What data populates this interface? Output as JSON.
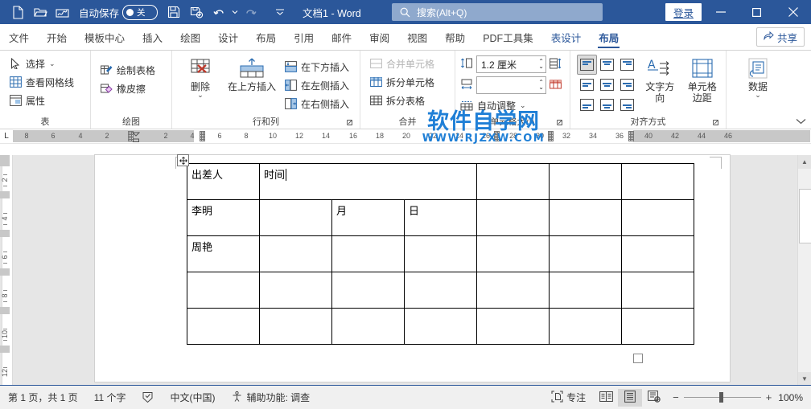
{
  "titlebar": {
    "qat": [
      {
        "name": "new-document-icon",
        "label": "新建"
      },
      {
        "name": "open-folder-icon",
        "label": "打开"
      },
      {
        "name": "signature-icon",
        "label": "签名"
      }
    ],
    "autosave_label": "自动保存",
    "autosave_state": "关",
    "qat2": [
      {
        "name": "save-icon",
        "label": "保存"
      },
      {
        "name": "save-as-icon",
        "label": "另存为"
      },
      {
        "name": "undo-icon",
        "label": "撤消"
      },
      {
        "name": "redo-icon",
        "label": "恢复"
      },
      {
        "name": "customize-qat-icon",
        "label": "自定义快速访问工具栏"
      }
    ],
    "document_title": "文档1  -  Word",
    "search_placeholder": "搜索(Alt+Q)",
    "signin_label": "登录",
    "window_buttons": [
      "最小化",
      "最大化",
      "关闭"
    ]
  },
  "tabs": [
    {
      "label": "文件",
      "style": "normal"
    },
    {
      "label": "开始",
      "style": "normal"
    },
    {
      "label": "模板中心",
      "style": "normal"
    },
    {
      "label": "插入",
      "style": "normal"
    },
    {
      "label": "绘图",
      "style": "normal"
    },
    {
      "label": "设计",
      "style": "normal"
    },
    {
      "label": "布局",
      "style": "normal"
    },
    {
      "label": "引用",
      "style": "normal"
    },
    {
      "label": "邮件",
      "style": "normal"
    },
    {
      "label": "审阅",
      "style": "normal"
    },
    {
      "label": "视图",
      "style": "normal"
    },
    {
      "label": "帮助",
      "style": "normal"
    },
    {
      "label": "PDF工具集",
      "style": "normal"
    },
    {
      "label": "表设计",
      "style": "blue"
    },
    {
      "label": "布局",
      "style": "active"
    }
  ],
  "share_label": "共享",
  "ribbon": {
    "groups": [
      {
        "title": "表",
        "items": [
          {
            "label": "选择",
            "icon": "select-arrow-icon",
            "dropdown": true
          },
          {
            "label": "查看网格线",
            "icon": "view-gridlines-icon",
            "dropdown": false
          },
          {
            "label": "属性",
            "icon": "table-properties-icon",
            "dropdown": false
          }
        ]
      },
      {
        "title": "绘图",
        "items": [
          {
            "label": "绘制表格",
            "icon": "draw-table-icon",
            "dropdown": false
          },
          {
            "label": "橡皮擦",
            "icon": "eraser-icon",
            "dropdown": false
          }
        ]
      },
      {
        "title": "行和列",
        "big": [
          {
            "label": "删除",
            "icon": "delete-table-icon",
            "dropdown": true
          },
          {
            "label": "在上方插入",
            "icon": "insert-above-icon",
            "dropdown": false
          }
        ],
        "items": [
          {
            "label": "在下方插入",
            "icon": "insert-below-icon"
          },
          {
            "label": "在左侧插入",
            "icon": "insert-left-icon"
          },
          {
            "label": "在右侧插入",
            "icon": "insert-right-icon"
          }
        ],
        "has_dialog_launcher": true
      },
      {
        "title": "合并",
        "items": [
          {
            "label": "合并单元格",
            "icon": "merge-cells-icon",
            "disabled": true
          },
          {
            "label": "拆分单元格",
            "icon": "split-cells-icon",
            "disabled": false
          },
          {
            "label": "拆分表格",
            "icon": "split-table-icon",
            "disabled": false
          }
        ]
      },
      {
        "title": "单元格大小",
        "height_value": "1.2 厘米",
        "width_value": "",
        "height_icon": "row-height-icon",
        "width_icon": "column-width-icon",
        "distribute_rows_icon": "distribute-rows-icon",
        "distribute_cols_icon": "distribute-columns-icon",
        "autofit_label": "自动调整",
        "autofit_icon": "autofit-icon",
        "has_dialog_launcher": true
      },
      {
        "title": "对齐方式",
        "align_buttons": [
          "align-top-left",
          "align-top-center",
          "align-top-right",
          "align-middle-left",
          "align-middle-center",
          "align-middle-right",
          "align-bottom-left",
          "align-bottom-center",
          "align-bottom-right"
        ],
        "selected_align": 0,
        "text_direction_label": "文字方向",
        "text_direction_icon": "text-direction-icon",
        "cell_margins_label": "单元格\n边距",
        "cell_margins_line1": "单元格",
        "cell_margins_line2": "边距",
        "cell_margins_icon": "cell-margins-icon",
        "has_dialog_launcher": true
      },
      {
        "title": "",
        "data_label": "数据",
        "data_icon": "data-sort-icon"
      }
    ],
    "collapse_label": "折叠功能区"
  },
  "watermark": {
    "line1": "软件自学网",
    "line2": "WWW.RJZXW.COM",
    "color": "#1f7fd6"
  },
  "ruler": {
    "corner_label": "L",
    "horizontal_left_numbers": [
      "8",
      "6",
      "4",
      "2"
    ],
    "horizontal_numbers": [
      "2",
      "4",
      "6",
      "8",
      "10",
      "12",
      "14",
      "16",
      "18",
      "20",
      "22",
      "24",
      "26",
      "28",
      "30",
      "32",
      "34",
      "36",
      "38"
    ],
    "horizontal_right_numbers": [
      "40",
      "42",
      "44",
      "46"
    ],
    "vertical_numbers": [
      "2",
      "4",
      "6",
      "8",
      "10",
      "12"
    ]
  },
  "document": {
    "table": {
      "columns": 7,
      "rows": [
        {
          "cells": [
            {
              "text": "出差人",
              "colspan": 1
            },
            {
              "text": "时间",
              "colspan": 3,
              "caret": true
            },
            {
              "text": "",
              "colspan": 1
            },
            {
              "text": "",
              "colspan": 1
            },
            {
              "text": "",
              "colspan": 1
            }
          ]
        },
        {
          "cells": [
            {
              "text": "李明"
            },
            {
              "text": ""
            },
            {
              "text": "月"
            },
            {
              "text": "日"
            },
            {
              "text": ""
            },
            {
              "text": ""
            },
            {
              "text": ""
            }
          ]
        },
        {
          "cells": [
            {
              "text": "周艳"
            },
            {
              "text": ""
            },
            {
              "text": ""
            },
            {
              "text": ""
            },
            {
              "text": ""
            },
            {
              "text": ""
            },
            {
              "text": ""
            }
          ]
        },
        {
          "cells": [
            {
              "text": ""
            },
            {
              "text": ""
            },
            {
              "text": ""
            },
            {
              "text": ""
            },
            {
              "text": ""
            },
            {
              "text": ""
            },
            {
              "text": ""
            }
          ]
        },
        {
          "cells": [
            {
              "text": ""
            },
            {
              "text": ""
            },
            {
              "text": ""
            },
            {
              "text": ""
            },
            {
              "text": ""
            },
            {
              "text": ""
            },
            {
              "text": ""
            }
          ]
        }
      ]
    }
  },
  "statusbar": {
    "page_info": "第 1 页，共 1 页",
    "word_count": "11 个字",
    "proofing_icon": "proofing-errors-icon",
    "language": "中文(中国)",
    "accessibility": "辅助功能: 调查",
    "focus_label": "专注",
    "focus_icon": "focus-mode-icon",
    "view_read_icon": "read-mode-icon",
    "view_print_icon": "print-layout-icon",
    "view_web_icon": "web-layout-icon",
    "selected_view": "print-layout",
    "zoom_out": "−",
    "zoom_in": "+",
    "zoom_level": "100%"
  }
}
